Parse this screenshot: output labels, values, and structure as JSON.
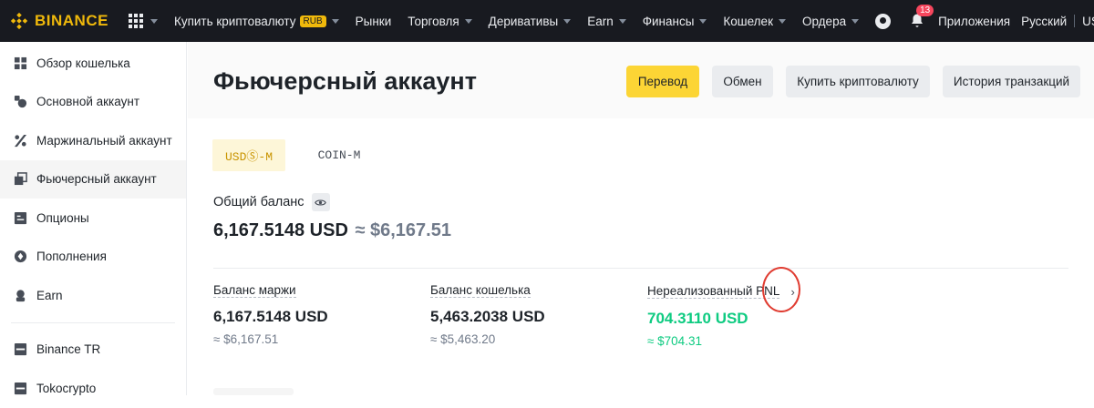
{
  "topbar": {
    "logo": "BINANCE",
    "nav": [
      {
        "label": "Купить криптовалюту",
        "badge": "RUB",
        "dropdown": true
      },
      {
        "label": "Рынки",
        "dropdown": false
      },
      {
        "label": "Торговля",
        "dropdown": true
      },
      {
        "label": "Деривативы",
        "dropdown": true
      },
      {
        "label": "Earn",
        "dropdown": true
      },
      {
        "label": "Финансы",
        "dropdown": true
      }
    ],
    "wallet": "Кошелек",
    "orders": "Ордера",
    "notifications_count": "13",
    "apps": "Приложения",
    "language": "Русский",
    "currency": "USD"
  },
  "sidebar": {
    "items": [
      {
        "label": "Обзор кошелька",
        "icon": "dashboard-icon"
      },
      {
        "label": "Основной аккаунт",
        "icon": "spot-icon"
      },
      {
        "label": "Маржинальный аккаунт",
        "icon": "margin-percent-icon"
      },
      {
        "label": "Фьючерсный аккаунт",
        "icon": "futures-icon",
        "active": true
      },
      {
        "label": "Опционы",
        "icon": "options-icon"
      },
      {
        "label": "Пополнения",
        "icon": "funding-icon"
      },
      {
        "label": "Earn",
        "icon": "earn-icon"
      }
    ],
    "items_after_divider": [
      {
        "label": "Binance TR",
        "icon": "binance-tr-icon"
      },
      {
        "label": "Tokocrypto",
        "icon": "tokocrypto-icon"
      }
    ]
  },
  "header": {
    "title": "Фьючерсный аккаунт",
    "buttons": {
      "transfer": "Перевод",
      "exchange": "Обмен",
      "buy_crypto": "Купить криптовалюту",
      "history": "История транзакций"
    }
  },
  "tabs": {
    "usds_m": "USDⓈ-M",
    "coin_m": "COIN-M",
    "active": "usds_m"
  },
  "balance": {
    "label": "Общий баланс",
    "value": "6,167.5148 USD",
    "approx": "≈ $6,167.51"
  },
  "stats": {
    "margin": {
      "label": "Баланс маржи",
      "value": "6,167.5148 USD",
      "approx": "≈ $6,167.51"
    },
    "wallet": {
      "label": "Баланс кошелька",
      "value": "5,463.2038 USD",
      "approx": "≈ $5,463.20"
    },
    "pnl": {
      "label": "Нереализованный PNL",
      "value": "704.3110 USD",
      "approx": "≈ $704.31"
    }
  },
  "colors": {
    "brand": "#F0B90B",
    "primary_button": "#FCD535",
    "positive": "#0ECB81",
    "topbar": "#181A20",
    "annotation": "#E03C31"
  }
}
